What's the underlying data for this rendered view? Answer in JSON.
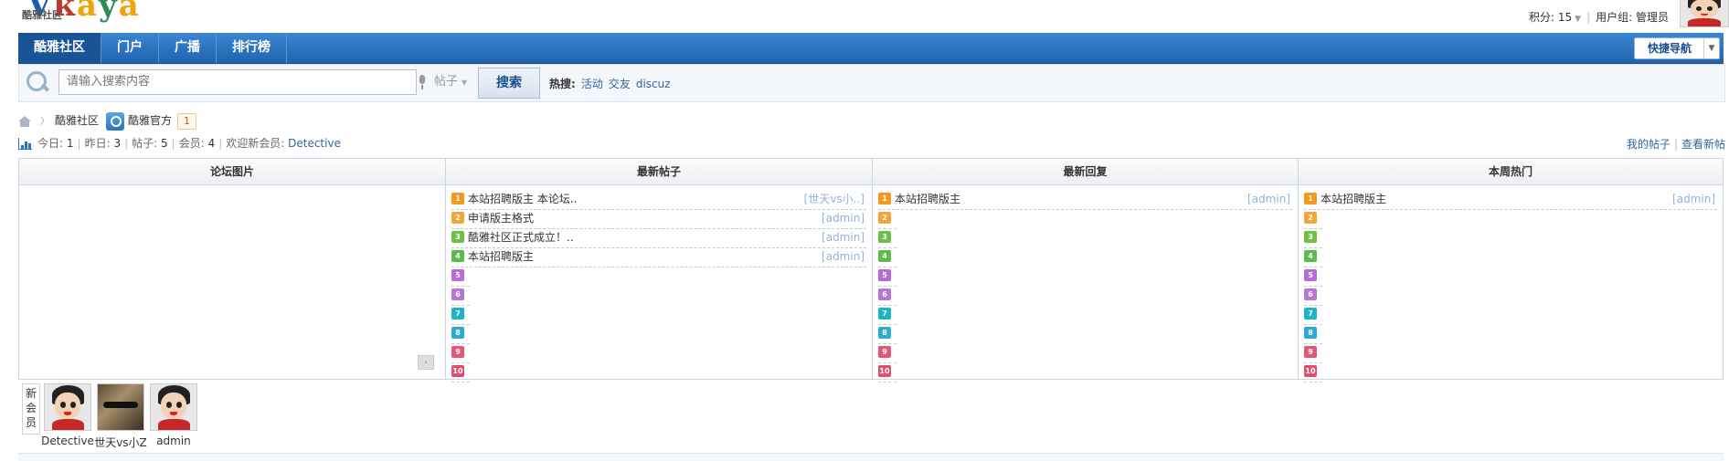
{
  "header": {
    "logo_text": [
      "V",
      "k",
      "a",
      "y",
      "a"
    ],
    "logo_sub": "酷雅社区",
    "points_label": "积分: 15",
    "user_group_label": "用户组: 管理员"
  },
  "nav": {
    "items": [
      {
        "label": "酷雅社区"
      },
      {
        "label": "门户"
      },
      {
        "label": "广播"
      },
      {
        "label": "排行榜"
      }
    ],
    "quick_nav": "快捷导航"
  },
  "search": {
    "placeholder": "请输入搜索内容",
    "type": "帖子",
    "button": "搜索",
    "hot_label": "热搜:",
    "hot_items": [
      "活动",
      "交友",
      "discuz"
    ]
  },
  "breadcrumb": {
    "home": "酷雅社区",
    "forum": "酷雅官方",
    "count": "1"
  },
  "stats": {
    "today_label": "今日:",
    "today": "1",
    "yesterday_label": "昨日:",
    "yesterday": "3",
    "posts_label": "帖子:",
    "posts": "5",
    "members_label": "会员:",
    "members": "4",
    "welcome_label": "欢迎新会员:",
    "newest_member": "Detective",
    "my_posts": "我的帖子",
    "new_posts": "查看新帖"
  },
  "columns": {
    "pics": {
      "title": "论坛图片"
    },
    "latest_threads": {
      "title": "最新帖子",
      "rows": [
        {
          "n": "1",
          "title": "本站招聘版主 本论坛..",
          "author": "[世天vs小..]"
        },
        {
          "n": "2",
          "title": "申请版主格式",
          "author": "[admin]"
        },
        {
          "n": "3",
          "title": "酷雅社区正式成立！..",
          "author": "[admin]"
        },
        {
          "n": "4",
          "title": "本站招聘版主",
          "author": "[admin]"
        },
        {
          "n": "5",
          "title": "",
          "author": ""
        },
        {
          "n": "6",
          "title": "",
          "author": ""
        },
        {
          "n": "7",
          "title": "",
          "author": ""
        },
        {
          "n": "8",
          "title": "",
          "author": ""
        },
        {
          "n": "9",
          "title": "",
          "author": ""
        },
        {
          "n": "10",
          "title": "",
          "author": ""
        }
      ]
    },
    "latest_replies": {
      "title": "最新回复",
      "rows": [
        {
          "n": "1",
          "title": "本站招聘版主",
          "author": "[admin]"
        },
        {
          "n": "2",
          "title": "",
          "author": ""
        },
        {
          "n": "3",
          "title": "",
          "author": ""
        },
        {
          "n": "4",
          "title": "",
          "author": ""
        },
        {
          "n": "5",
          "title": "",
          "author": ""
        },
        {
          "n": "6",
          "title": "",
          "author": ""
        },
        {
          "n": "7",
          "title": "",
          "author": ""
        },
        {
          "n": "8",
          "title": "",
          "author": ""
        },
        {
          "n": "9",
          "title": "",
          "author": ""
        },
        {
          "n": "10",
          "title": "",
          "author": ""
        }
      ]
    },
    "weekly_hot": {
      "title": "本周热门",
      "rows": [
        {
          "n": "1",
          "title": "本站招聘版主",
          "author": "[admin]"
        },
        {
          "n": "2",
          "title": "",
          "author": ""
        },
        {
          "n": "3",
          "title": "",
          "author": ""
        },
        {
          "n": "4",
          "title": "",
          "author": ""
        },
        {
          "n": "5",
          "title": "",
          "author": ""
        },
        {
          "n": "6",
          "title": "",
          "author": ""
        },
        {
          "n": "7",
          "title": "",
          "author": ""
        },
        {
          "n": "8",
          "title": "",
          "author": ""
        },
        {
          "n": "9",
          "title": "",
          "author": ""
        },
        {
          "n": "10",
          "title": "",
          "author": ""
        }
      ]
    }
  },
  "new_members": {
    "label": "新会员",
    "items": [
      {
        "name": "Detective",
        "avatar": "cartoon-avatar"
      },
      {
        "name": "世天vs小Z",
        "avatar": "photo-avatar"
      },
      {
        "name": "admin",
        "avatar": "cartoon-avatar"
      }
    ]
  }
}
